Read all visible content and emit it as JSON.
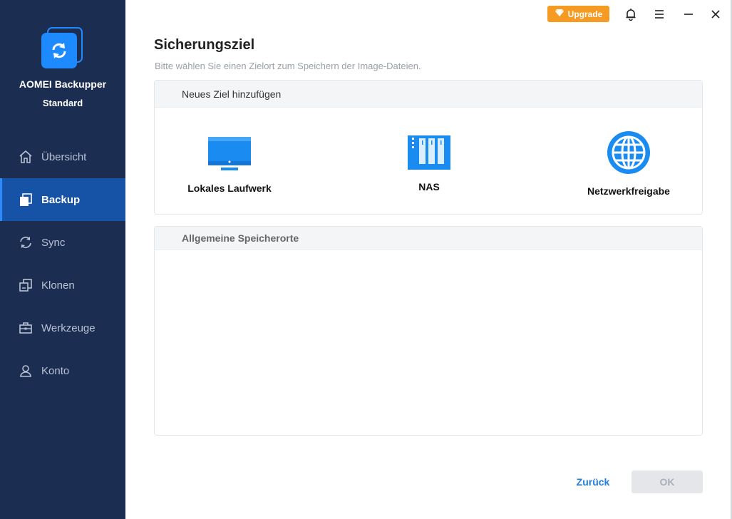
{
  "app": {
    "name": "AOMEI Backupper",
    "edition": "Standard"
  },
  "titlebar": {
    "upgrade_label": "Upgrade"
  },
  "sidebar": {
    "items": [
      {
        "label": "Übersicht",
        "icon": "home-icon",
        "active": false
      },
      {
        "label": "Backup",
        "icon": "backup-icon",
        "active": true
      },
      {
        "label": "Sync",
        "icon": "sync-icon",
        "active": false
      },
      {
        "label": "Klonen",
        "icon": "clone-icon",
        "active": false
      },
      {
        "label": "Werkzeuge",
        "icon": "toolbox-icon",
        "active": false
      },
      {
        "label": "Konto",
        "icon": "user-icon",
        "active": false
      }
    ]
  },
  "main": {
    "title": "Sicherungsziel",
    "subtitle": "Bitte wählen Sie einen Zielort zum Speichern der Image-Dateien.",
    "new_target": {
      "header": "Neues Ziel hinzufügen",
      "options": [
        {
          "label": "Lokales Laufwerk",
          "icon": "local-drive-icon"
        },
        {
          "label": "NAS",
          "icon": "nas-icon"
        },
        {
          "label": "Netzwerkfreigabe",
          "icon": "network-share-icon"
        }
      ]
    },
    "common_locations": {
      "header": "Allgemeine Speicherorte"
    }
  },
  "footer": {
    "back_label": "Zurück",
    "ok_label": "OK"
  },
  "colors": {
    "sidebar": "#1b2e52",
    "active": "#1653a6",
    "accent": "#1d8aff",
    "upgrade": "#f59a23"
  }
}
